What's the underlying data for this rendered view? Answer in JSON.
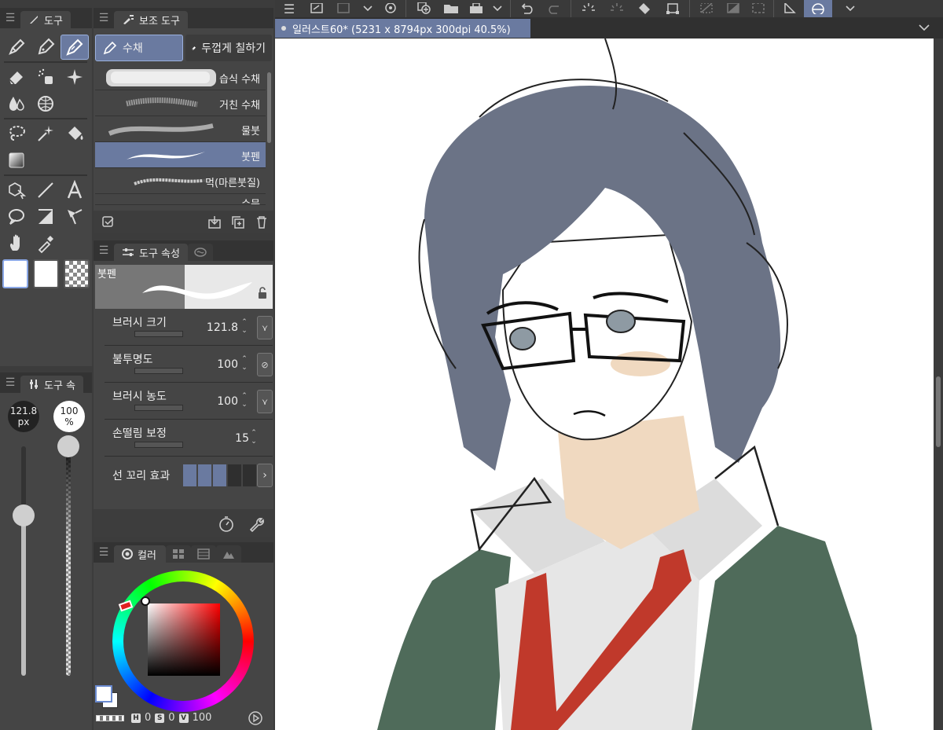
{
  "tool_panel": {
    "tab_label": "도구",
    "tools": [
      {
        "name": "pen-tool-icon"
      },
      {
        "name": "pencil-tool-icon"
      },
      {
        "name": "brush-tool-icon",
        "active": true
      },
      {
        "name": "eraser-tool-icon"
      },
      {
        "name": "airbrush-tool-icon"
      },
      {
        "name": "decoration-tool-icon"
      },
      {
        "name": "blend-tool-icon"
      },
      {
        "name": "liquify-tool-icon"
      }
    ]
  },
  "size_panel": {
    "tab_label": "도구 속",
    "brush_size_value": "121.8",
    "brush_size_unit": "px",
    "opacity_value": "100",
    "opacity_unit": "%",
    "size_slider_level": 0.7,
    "opacity_slider_level": 1.0
  },
  "subtool_panel": {
    "tab_label": "보조 도구",
    "tabs": [
      {
        "label": "수채",
        "active": true
      },
      {
        "label": "두껍게 칠하기"
      }
    ],
    "brushes": [
      {
        "label": "습식 수채"
      },
      {
        "label": "거친 수채"
      },
      {
        "label": "물붓"
      },
      {
        "label": "붓펜",
        "active": true
      },
      {
        "label": "먹(마른붓질)"
      },
      {
        "label": "수묵"
      }
    ]
  },
  "property_panel": {
    "tab_label": "도구 속성",
    "preview_label": "붓펜",
    "rows": [
      {
        "label": "브러시 크기",
        "value": "121.8"
      },
      {
        "label": "불투명도",
        "value": "100"
      },
      {
        "label": "브러시 농도",
        "value": "100"
      },
      {
        "label": "손떨림 보정",
        "value": "15"
      },
      {
        "label": "선 꼬리 효과",
        "value": ""
      }
    ],
    "taper_level": 3,
    "taper_total": 5
  },
  "color_panel": {
    "tab_label": "컬러",
    "h_label": "H",
    "h_value": "0",
    "s_label": "S",
    "s_value": "0",
    "v_label": "V",
    "v_value": "100",
    "main_color": "#ffffff",
    "sub_color": "#ffffff"
  },
  "document": {
    "title": "일러스트60* (5231 x 8794px 300dpi 40.5%)"
  },
  "colors": {
    "accent": "#6a7aa0",
    "hair": "#6b7386",
    "jacket": "#4f6b5a",
    "tie": "#c0392b",
    "skin": "#f0d9c0"
  }
}
